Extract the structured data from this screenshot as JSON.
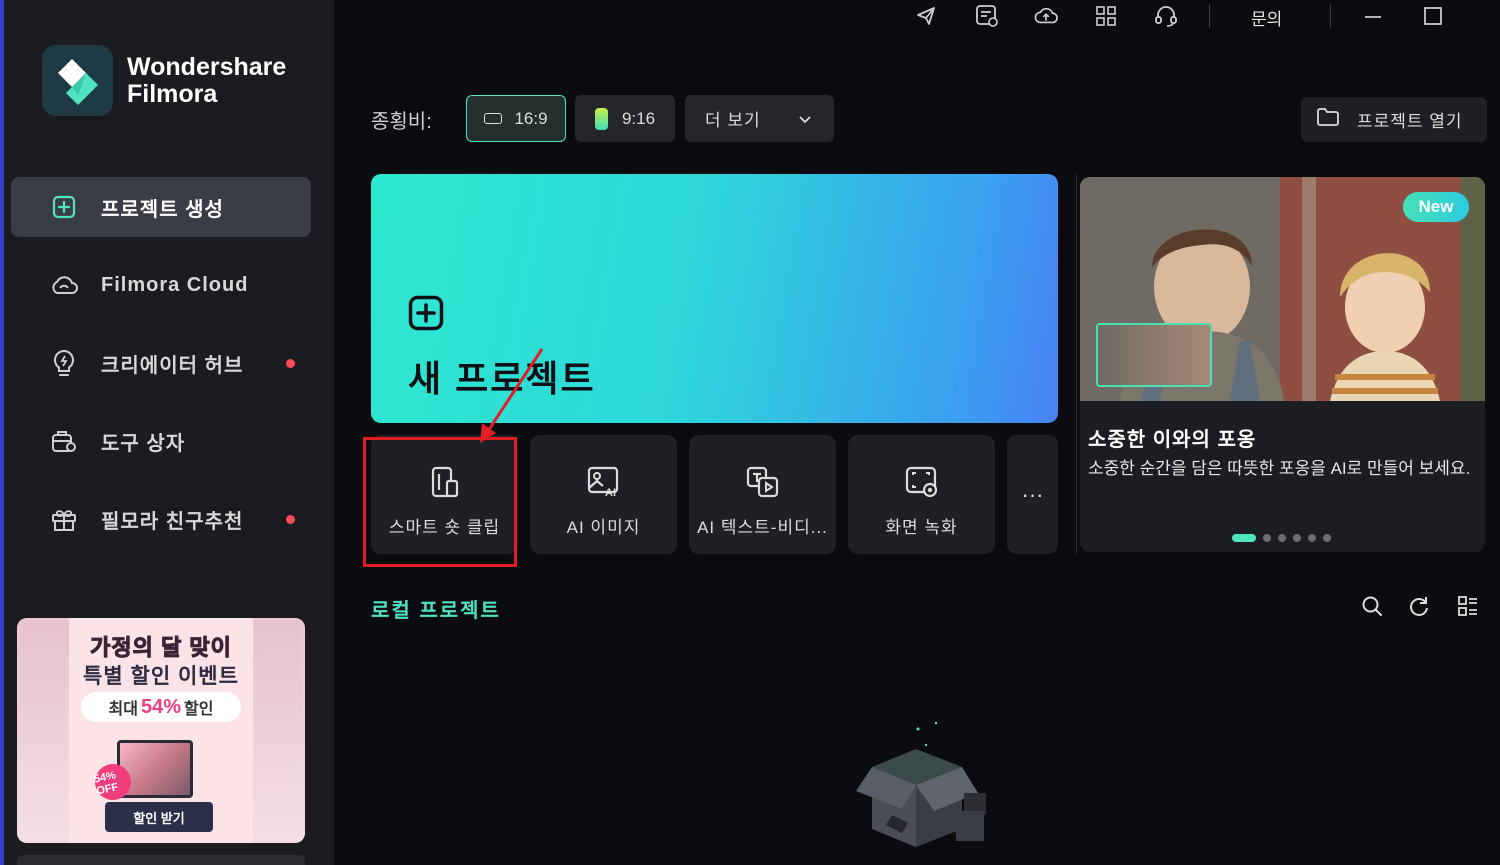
{
  "app": {
    "brand_line1": "Wondershare",
    "brand_line2": "Filmora"
  },
  "topbar": {
    "icons": [
      "send-feedback-icon",
      "news-icon",
      "cloud-upload-icon",
      "apps-grid-icon",
      "support-headset-icon"
    ],
    "inquiry": "문의",
    "window_controls": [
      "minimize-icon",
      "maximize-icon"
    ]
  },
  "sidebar": {
    "items": [
      {
        "label": "프로젝트 생성",
        "icon": "add-square-icon",
        "active": true,
        "dot": false
      },
      {
        "label": "Filmora Cloud",
        "icon": "cloud-icon",
        "active": false,
        "dot": false
      },
      {
        "label": "크리에이터 허브",
        "icon": "lightbulb-icon",
        "active": false,
        "dot": true
      },
      {
        "label": "도구 상자",
        "icon": "toolbox-icon",
        "active": false,
        "dot": false
      },
      {
        "label": "필모라 친구추천",
        "icon": "gift-icon",
        "active": false,
        "dot": true
      }
    ]
  },
  "promo": {
    "line1": "가정의 달 맞이",
    "line2": "특별 할인 이벤트",
    "pill_prefix": "최대",
    "pill_percent": "54%",
    "pill_suffix": "할인",
    "badge": "54% OFF",
    "button": "할인 받기"
  },
  "aspect": {
    "label": "종횡비:",
    "options": [
      {
        "label": "16:9",
        "selected": true
      },
      {
        "label": "9:16",
        "selected": false
      }
    ],
    "more": "더 보기",
    "open_project": "프로젝트 열기"
  },
  "hero": {
    "title": "새 프로젝트"
  },
  "tools": [
    {
      "label": "스마트 숏 클립",
      "icon": "smart-short-clip-icon"
    },
    {
      "label": "AI 이미지",
      "icon": "ai-image-icon"
    },
    {
      "label": "AI 텍스트-비디...",
      "icon": "ai-text-to-video-icon"
    },
    {
      "label": "화면 녹화",
      "icon": "screen-record-icon"
    }
  ],
  "tools_more": "···",
  "feature": {
    "badge": "New",
    "title": "소중한 이와의 포옹",
    "description": "소중한 순간을 담은 따뜻한 포옹을 AI로 만들어 보세요.",
    "page_count": 6,
    "active_page": 1
  },
  "local": {
    "title": "로컬 프로젝트",
    "icons": [
      "search-icon",
      "refresh-icon",
      "view-toggle-icon"
    ]
  },
  "colors": {
    "accent": "#4fe3c0",
    "highlight_box": "#e11d25",
    "notification_dot": "#ff4b5c"
  }
}
